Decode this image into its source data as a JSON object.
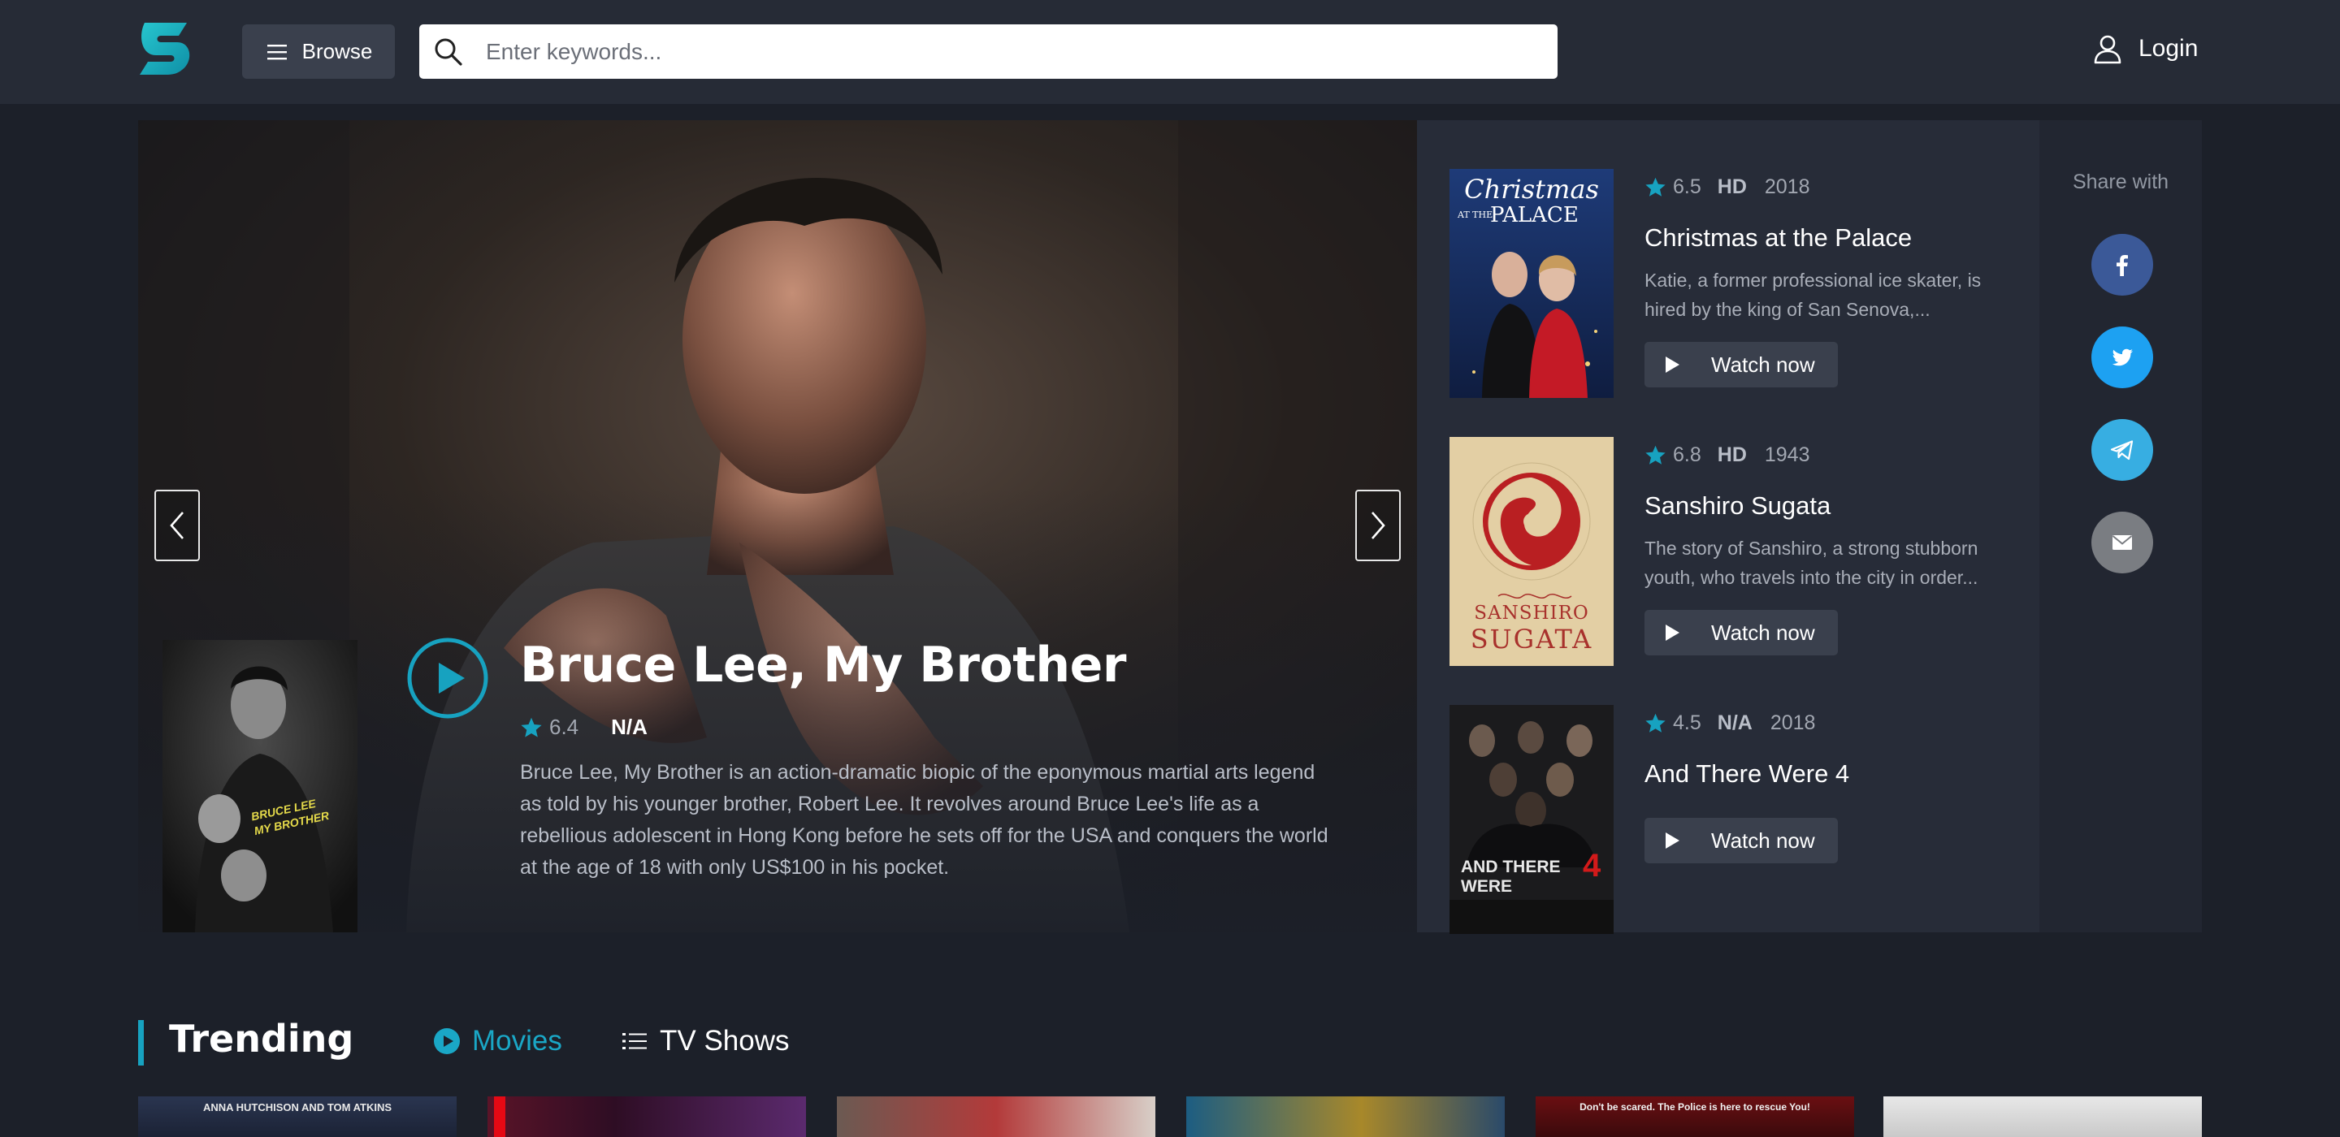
{
  "header": {
    "browse_label": "Browse",
    "search_placeholder": "Enter keywords...",
    "login_label": "Login"
  },
  "hero": {
    "title": "Bruce Lee, My Brother",
    "rating": "6.4",
    "quality": "N/A",
    "description": "Bruce Lee, My Brother is an action-dramatic biopic of the eponymous martial arts legend as told by his younger brother, Robert Lee. It revolves around Bruce Lee's life as a rebellious adolescent in Hong Kong before he sets off for the USA and conquers the world at the age of 18 with only US$100 in his pocket.",
    "poster_text": "BRUCE LEE MY BROTHER"
  },
  "side_items": [
    {
      "rating": "6.5",
      "quality": "HD",
      "year": "2018",
      "title": "Christmas at the Palace",
      "description": "Katie, a former professional ice skater, is hired by the king of San Senova,...",
      "poster_text_1": "Christmas",
      "poster_text_2": "AT THE",
      "poster_text_3": "PALACE"
    },
    {
      "rating": "6.8",
      "quality": "HD",
      "year": "1943",
      "title": "Sanshiro Sugata",
      "description": "The story of Sanshiro, a strong stubborn youth, who travels into the city in order...",
      "poster_text_1": "SANSHIRO",
      "poster_text_2": "SUGATA"
    },
    {
      "rating": "4.5",
      "quality": "N/A",
      "year": "2018",
      "title": "And There Were 4",
      "description": "",
      "poster_text_1": "AND THERE WERE",
      "poster_text_2": "4"
    }
  ],
  "watch_label": "Watch now",
  "share": {
    "label": "Share with"
  },
  "trending": {
    "title": "Trending",
    "tabs": {
      "movies": "Movies",
      "tv": "TV Shows"
    },
    "card_captions": [
      "ANNA HUTCHISON     AND TOM ATKINS",
      "",
      "",
      "",
      "Don't be scared. The Police is here to rescue You!",
      ""
    ]
  },
  "colors": {
    "accent": "#17a2c0",
    "page_bg": "#1c2029",
    "header_bg": "#262b36",
    "facebook": "#3b5998",
    "twitter": "#1da1f2",
    "telegram": "#37aee2",
    "email": "#7a7d82"
  }
}
